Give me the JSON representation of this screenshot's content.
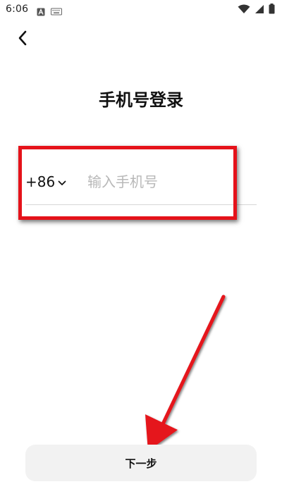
{
  "status_bar": {
    "time": "6:06",
    "icons": [
      "notification-a-icon",
      "keyboard-icon",
      "wifi-icon",
      "signal-icon",
      "battery-icon"
    ]
  },
  "header": {
    "back_icon": "chevron-left-icon"
  },
  "page": {
    "title": "手机号登录"
  },
  "phone_form": {
    "country_code": "+86",
    "dropdown_icon": "chevron-down-icon",
    "phone_placeholder": "输入手机号",
    "phone_value": ""
  },
  "actions": {
    "next_label": "下一步"
  },
  "annotations": {
    "highlight_color": "#e5121a",
    "arrow_color": "#e5121a"
  },
  "colors": {
    "background": "#ffffff",
    "text": "#111111",
    "placeholder": "#b8b8b8",
    "button_bg": "#f2f2f2",
    "divider": "#d6d6d6"
  }
}
